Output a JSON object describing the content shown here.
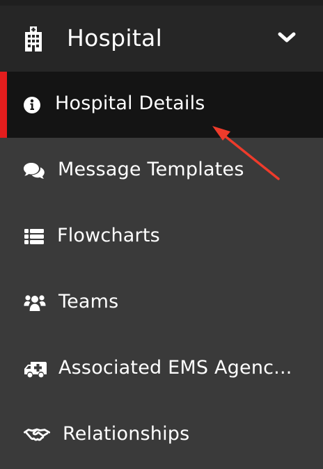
{
  "header": {
    "title": "Hospital",
    "icon": "hospital-building-icon",
    "toggle_icon": "chevron-down-icon"
  },
  "menu": {
    "items": [
      {
        "label": "Hospital Details",
        "icon": "info-circle-icon",
        "active": true
      },
      {
        "label": "Message Templates",
        "icon": "comments-icon",
        "active": false
      },
      {
        "label": "Flowcharts",
        "icon": "list-icon",
        "active": false
      },
      {
        "label": "Teams",
        "icon": "users-icon",
        "active": false
      },
      {
        "label": "Associated EMS Agenc...",
        "icon": "ambulance-icon",
        "active": false
      },
      {
        "label": "Relationships",
        "icon": "handshake-icon",
        "active": false
      }
    ]
  },
  "colors": {
    "background": "#3a3a3a",
    "header_bg": "#262626",
    "active_bg": "#141414",
    "accent": "#e31d1d",
    "text": "#ffffff",
    "annotation_arrow": "#ee3b2b"
  }
}
